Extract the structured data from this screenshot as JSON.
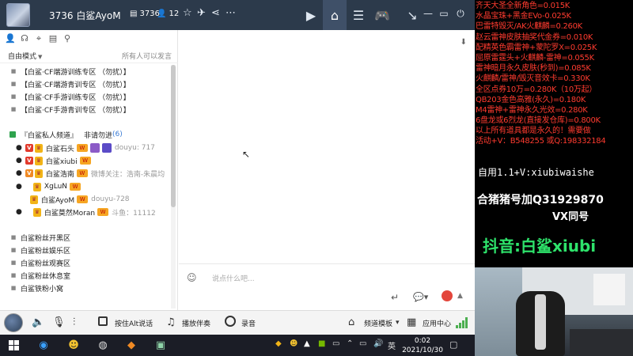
{
  "titlebar": {
    "channel_title": "3736 白鲨AyoM",
    "id_icon": "id-card-icon",
    "id_value": "3736",
    "user_icon": "person-icon",
    "online_count": "12",
    "nav": [
      "video-icon",
      "home-icon",
      "list-icon",
      "gamepad-icon",
      "minimize-to-tray-icon"
    ],
    "window_controls": [
      "minimize-icon",
      "restore-icon",
      "power-icon"
    ]
  },
  "left_panel": {
    "mode_label": "自由模式",
    "mode_hint": "所有人可以发言",
    "channels_top": [
      "【白鲨·CF端游训练专区  （勿扰）】",
      "【白鲨·CF端游青训专区  （勿扰）】",
      "【白鲨·CF手游训练专区  （勿扰）】",
      "【白鲨·CF手游青训专区  （勿扰）】"
    ],
    "private_channel": "『白鲨私人频道』",
    "private_note": "非请勿进",
    "private_count": "(6)",
    "users": [
      {
        "name": "白鲨石头",
        "note": "douyu: 717"
      },
      {
        "name": "白鲨xiubi",
        "note": ""
      },
      {
        "name": "白鲨浩南",
        "note": "微博关注：浩南-朱晨均"
      },
      {
        "name": "XgLuN",
        "note": ""
      },
      {
        "name": "白鲨AyoM",
        "note": "douyu-728"
      },
      {
        "name": "白鲨莫然Moran",
        "note": "斗鱼：11112"
      }
    ],
    "channels_bottom": [
      "白鲨粉丝开黑区",
      "白鲨粉丝娱乐区",
      "白鲨粉丝观赛区",
      "白鲨粉丝休息室",
      "白鲨铁粉小窝"
    ]
  },
  "chat": {
    "placeholder": "说点什么吧..."
  },
  "bottombar": {
    "push_to_talk": "按住Alt说话",
    "accompaniment": "播放伴奏",
    "record": "录音",
    "channel_template": "频道模板",
    "app_center": "应用中心"
  },
  "taskbar": {
    "ime": "英",
    "time": "0:02",
    "date": "2021/10/30"
  },
  "overlay": {
    "lines": [
      "齐天大圣全新角色=0.015K",
      "水晶宝珠+黑金EVo-0.025K",
      "巴雷特毁灭/AK火麒麟=0.260K",
      "赵云雷神皮肤抽奖代金券=0.010K",
      "配精英色霸雷神+蒙陀罗X=0.025K",
      "屈原雷霆头+火麒麟-雷神=0.055K",
      "雷神暗月永久皮肤(秒到)=0.085K",
      "火麒麟/雷神/毁灭音效卡=0.330K",
      "全区点券10万=0.280K（10万起）",
      "QB203金色高雅(永久)=0.180K",
      "M4雷神+雷神永久光效=0.280K",
      "6盘龙或6烈龙(直接发仓库)=0.800K",
      "以上所有道具都是永久的！需要做",
      "活动+V：B548255   或Q:198332184"
    ],
    "wechat": "自用1.1+V:xiubiwaishe",
    "qq": "合猪猪号加Q31929870",
    "vx": "VX同号",
    "douyin": "抖音:白鲨xiubi"
  },
  "colors": {
    "titlebar_bg": "#2c3a4b",
    "overlay_red": "#ff3b2f",
    "douyin_green": "#2ee36b",
    "taskbar_bg": "#1b1d26"
  }
}
